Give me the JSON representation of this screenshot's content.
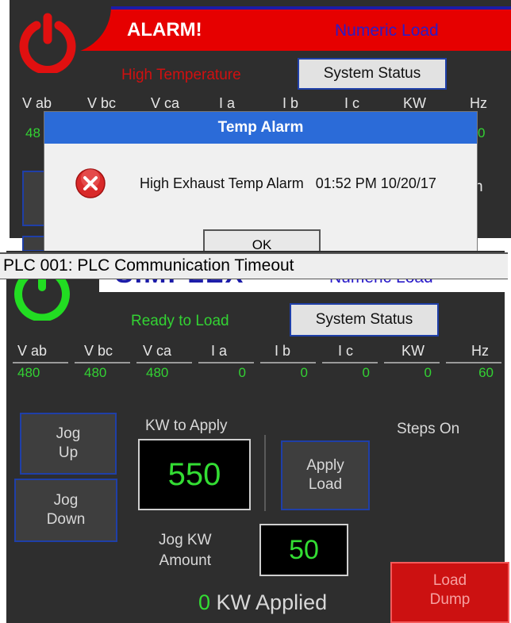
{
  "top_panel": {
    "alarm_title": "ALARM!",
    "numeric_load": "Numeric Load",
    "status_text": "High Temperature",
    "system_status_label": "System Status",
    "columns": [
      "V ab",
      "V bc",
      "V ca",
      "I a",
      "I b",
      "I c",
      "KW",
      "Hz"
    ],
    "visible_values": [
      "48",
      "0"
    ],
    "right_fragment": "n"
  },
  "dialog": {
    "title": "Temp Alarm",
    "message": "High Exhaust Temp Alarm   01:52 PM 10/20/17",
    "ok_label": "OK"
  },
  "banner": {
    "text": "PLC 001: PLC Communication Timeout"
  },
  "bottom_panel": {
    "logo_text": "SIMPLEX",
    "numeric_load": "Numeric Load",
    "status_text": "Ready to Load",
    "system_status_label": "System Status",
    "columns": [
      {
        "label": "V ab",
        "value": "480"
      },
      {
        "label": "V bc",
        "value": "480"
      },
      {
        "label": "V ca",
        "value": "480"
      },
      {
        "label": "I a",
        "value": "0"
      },
      {
        "label": "I b",
        "value": "0"
      },
      {
        "label": "I c",
        "value": "0"
      },
      {
        "label": "KW",
        "value": "0"
      },
      {
        "label": "Hz",
        "value": "60"
      }
    ],
    "jog_up": [
      "Jog",
      "Up"
    ],
    "jog_down": [
      "Jog",
      "Down"
    ],
    "kw_to_apply_label": "KW to Apply",
    "kw_to_apply_value": "550",
    "apply_load": [
      "Apply",
      "Load"
    ],
    "steps_on_label": "Steps On",
    "jog_kw_amount_label": [
      "Jog KW",
      "Amount"
    ],
    "jog_kw_amount_value": "50",
    "kw_applied_value": "0",
    "kw_applied_label": "KW Applied",
    "load_dump": [
      "Load",
      "Dump"
    ]
  },
  "colors": {
    "alarm_red": "#e60000",
    "header_blue": "#1c1ca8",
    "dialog_title_blue": "#2b6bd8",
    "status_green": "#33d233",
    "status_red": "#d01010",
    "panel_gray": "#2e2e2e",
    "power_icon_red": "#e01010",
    "power_icon_green": "#22dd22"
  }
}
